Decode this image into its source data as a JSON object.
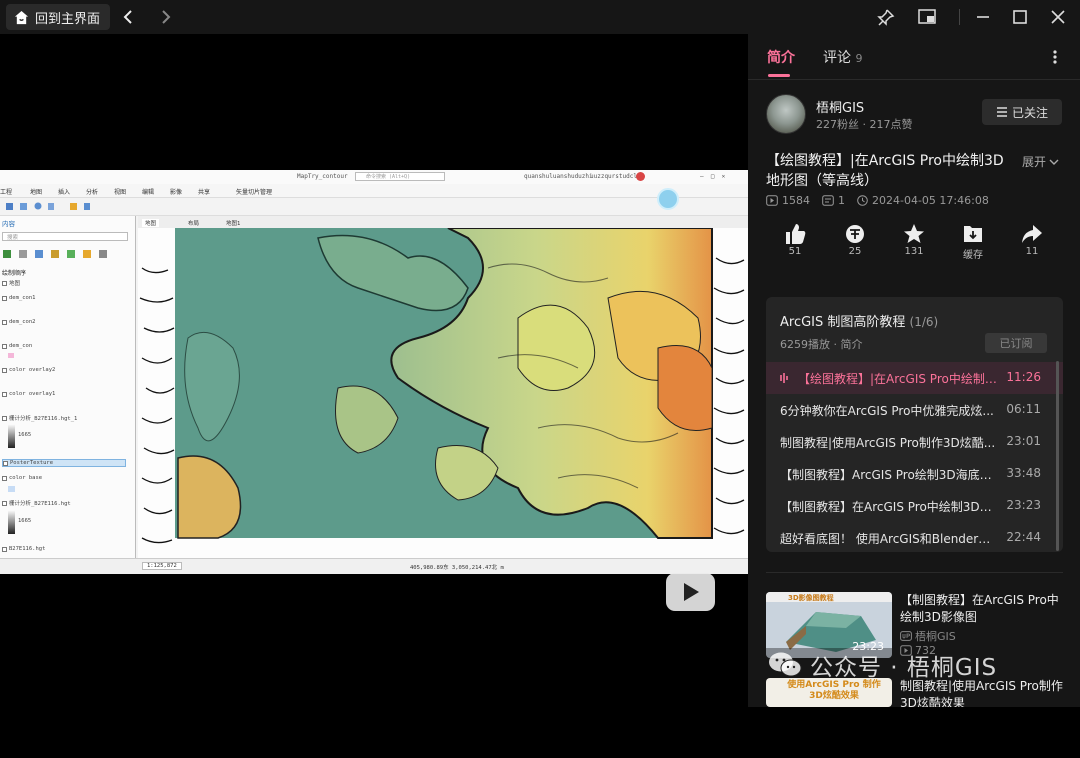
{
  "topbar": {
    "home_label": "回到主界面",
    "back_icon": "chevron-left",
    "forward_icon": "chevron-right"
  },
  "video": {
    "window_title": "MapTry_contour",
    "search_placeholder": "命令搜索 (Alt+Q)",
    "user": "quanshuluanshuduzhi",
    "org": "uuzzqurstudcl",
    "menus": [
      "工程",
      "地图",
      "插入",
      "分析",
      "视图",
      "编辑",
      "影像",
      "共享",
      "矢量切片管理"
    ],
    "contents_title": "内容",
    "contents_search": "搜索",
    "draw_order": "绘制顺序",
    "layers": [
      "地图",
      "dem_con1",
      "dem_con2",
      "dem_con",
      "color overlay2",
      "color overlay1",
      "栅计分析_B27E116.hgt_1",
      "1665",
      "PosterTexture",
      "color base",
      "栅计分析_B27E116.hgt",
      "1665",
      "B27E116.hgt"
    ],
    "map_tabs": [
      "地图",
      "布局",
      "地图1"
    ],
    "scale": "1:125,872",
    "coords": "405,980.89东 3,050,214.47北 m",
    "bottom_tab": "目录",
    "play_icon": "play"
  },
  "panel": {
    "tabs": [
      {
        "label": "简介"
      },
      {
        "label": "评论",
        "count": "9"
      }
    ],
    "author": {
      "name": "梧桐GIS",
      "stats": "227粉丝 · 217点赞",
      "follow_label": "已关注"
    },
    "title": "【绘图教程】|在ArcGIS Pro中绘制3D地形图（等高线）",
    "expand_label": "展开",
    "meta": {
      "plays": "1584",
      "danmaku": "1",
      "date": "2024-04-05 17:46:08"
    },
    "actions": [
      {
        "label": "51",
        "icon": "thumbs-up-icon"
      },
      {
        "label": "25",
        "icon": "coin-icon"
      },
      {
        "label": "131",
        "icon": "star-icon"
      },
      {
        "label": "缓存",
        "icon": "download-icon"
      },
      {
        "label": "11",
        "icon": "share-icon"
      }
    ],
    "collection": {
      "title": "ArcGIS 制图高阶教程",
      "progress": "(1/6)",
      "sub": "6259播放 · 简介",
      "subscribe_label": "已订阅",
      "episodes": [
        {
          "title": "【绘图教程】|在ArcGIS Pro中绘制3...",
          "duration": "11:26",
          "current": true
        },
        {
          "title": "6分钟教你在ArcGIS Pro中优雅完成炫...",
          "duration": "06:11"
        },
        {
          "title": "制图教程|使用ArcGIS Pro制作3D炫酷...",
          "duration": "23:01"
        },
        {
          "title": "【制图教程】ArcGIS Pro绘制3D海底地...",
          "duration": "33:48"
        },
        {
          "title": "【制图教程】在ArcGIS Pro中绘制3D影...",
          "duration": "23:23"
        },
        {
          "title": "超好看底图！ 使用ArcGIS和Blender制作",
          "duration": "22:44"
        }
      ]
    },
    "recommendations": [
      {
        "title": "【制图教程】在ArcGIS Pro中绘制3D影像图",
        "author": "梧桐GIS",
        "plays": "732",
        "duration": "23:23",
        "thumb_text": "3D影像图教程"
      },
      {
        "title": "制图教程|使用ArcGIS Pro制作3D炫酷效果",
        "thumb_text": "使用ArcGIS Pro 制作3D炫酷效果"
      }
    ]
  },
  "watermark": "公众号 · 梧桐GIS",
  "colors": {
    "accent": "#fb7299",
    "panel_bg": "#161616",
    "card_bg": "#252525"
  }
}
